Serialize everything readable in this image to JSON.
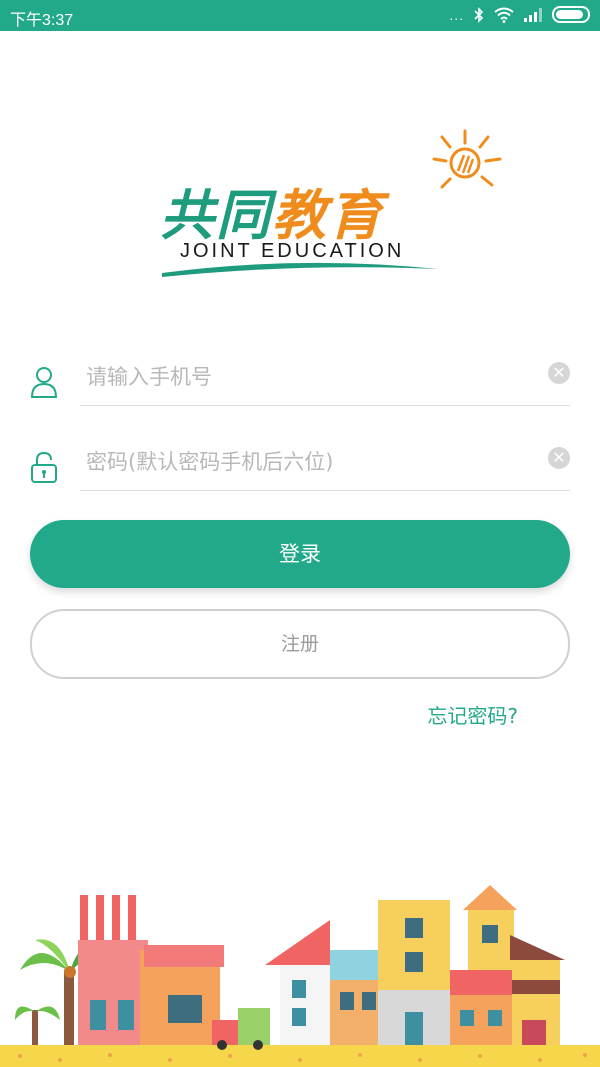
{
  "status_bar": {
    "time": "下午3:37",
    "dots": "...",
    "icons": [
      "bluetooth-icon",
      "wifi-icon",
      "signal-icon",
      "battery-icon"
    ]
  },
  "logo": {
    "title_part1": "共同",
    "title_part2": "教育",
    "subtitle": "JOINT EDUCATION",
    "brand_green": "#1f9b7d",
    "brand_orange": "#f08c1c"
  },
  "form": {
    "phone": {
      "placeholder": "请输入手机号",
      "value": ""
    },
    "password": {
      "placeholder": "密码(默认密码手机后六位)",
      "value": ""
    }
  },
  "buttons": {
    "login": "登录",
    "register": "注册",
    "forgot": "忘记密码?"
  },
  "colors": {
    "accent": "#22a98a"
  }
}
